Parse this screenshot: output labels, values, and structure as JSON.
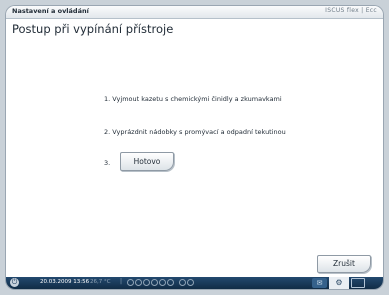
{
  "window": {
    "title": "Nastavení a ovládání",
    "brand": "ISCUS flex | Ecc"
  },
  "page": {
    "title": "Postup při vypínání přístroje"
  },
  "steps": [
    {
      "number": "1.",
      "text": "Vyjmout kazetu s chemickými činidly a zkumavkami"
    },
    {
      "number": "2.",
      "text": "Vyprázdnit nádobky s promývací a odpadní tekutinou"
    },
    {
      "number": "3."
    }
  ],
  "buttons": {
    "done_label": "Hotovo",
    "cancel_label": "Zrušit"
  },
  "statusbar": {
    "datetime": "20.03.2009 13:56",
    "temperature": "26,7 °C",
    "separator": "|"
  }
}
